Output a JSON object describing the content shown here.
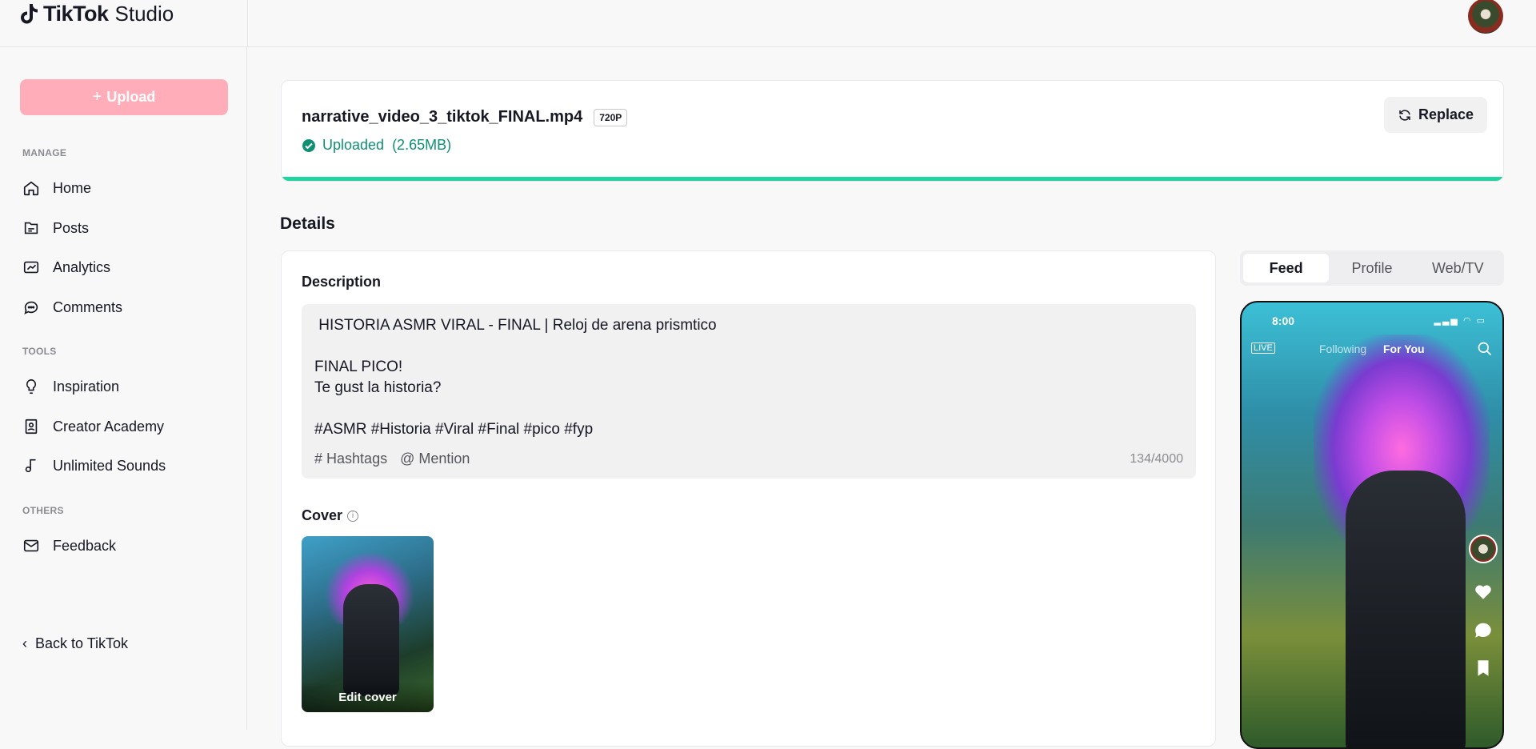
{
  "header": {
    "brand": "TikTok",
    "product": "Studio"
  },
  "sidebar": {
    "upload_label": "Upload",
    "sections": {
      "manage": "MANAGE",
      "tools": "TOOLS",
      "others": "OTHERS"
    },
    "items": [
      {
        "label": "Home",
        "icon": "home-icon"
      },
      {
        "label": "Posts",
        "icon": "posts-icon"
      },
      {
        "label": "Analytics",
        "icon": "analytics-icon"
      },
      {
        "label": "Comments",
        "icon": "comments-icon"
      },
      {
        "label": "Inspiration",
        "icon": "lightbulb-icon"
      },
      {
        "label": "Creator Academy",
        "icon": "academy-icon"
      },
      {
        "label": "Unlimited Sounds",
        "icon": "music-note-icon"
      },
      {
        "label": "Feedback",
        "icon": "mail-icon"
      }
    ],
    "back_label": "Back to TikTok"
  },
  "file": {
    "name": "narrative_video_3_tiktok_FINAL.mp4",
    "resolution": "720P",
    "status": "Uploaded  (2.65MB)",
    "replace_label": "Replace",
    "progress": 1.0
  },
  "details": {
    "title": "Details",
    "description_label": "Description",
    "description_text": " HISTORIA ASMR VIRAL - FINAL | Reloj de arena prismtico\n\nFINAL PICO!\nTe gust la historia?\n\n#ASMR #Historia #Viral #Final #pico #fyp",
    "hashtags_label": "Hashtags",
    "mention_label": "Mention",
    "char_count": "134/4000",
    "cover_label": "Cover",
    "edit_cover_label": "Edit cover"
  },
  "preview": {
    "tabs": [
      "Feed",
      "Profile",
      "Web/TV"
    ],
    "active_tab": "Feed",
    "phone": {
      "time": "8:00",
      "live": "LIVE",
      "following": "Following",
      "for_you": "For You"
    }
  },
  "colors": {
    "accent": "#fe2c55",
    "upload_disabled": "#ffadb9",
    "success": "#0f8f73",
    "progress": "#20d5a0"
  }
}
